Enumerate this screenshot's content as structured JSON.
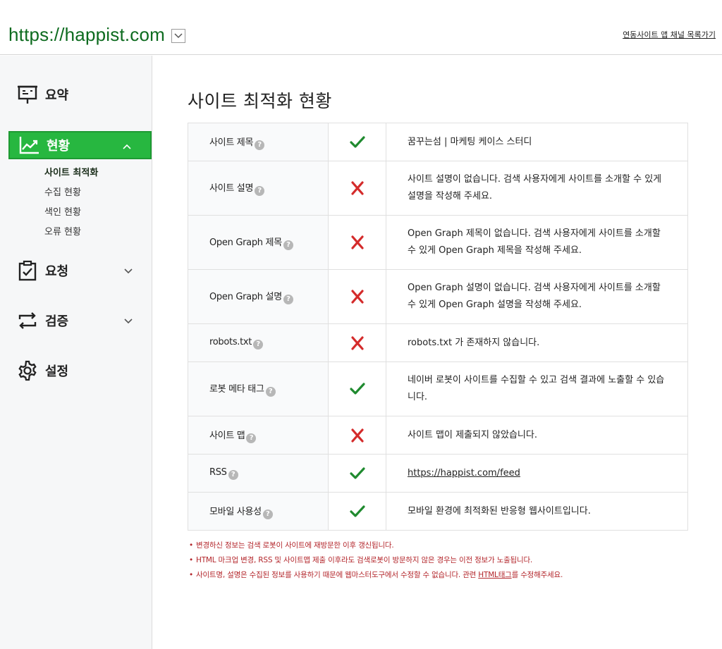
{
  "header": {
    "site_url": "https://happist.com",
    "link_label": "연동사이트 앱 채널 목록가기"
  },
  "sidebar": {
    "items": [
      {
        "label": "요약",
        "icon": "presentation-board-icon"
      },
      {
        "label": "현황",
        "icon": "trend-chart-icon",
        "active": true
      },
      {
        "label": "요청",
        "icon": "clipboard-check-icon"
      },
      {
        "label": "검증",
        "icon": "swap-arrows-icon"
      },
      {
        "label": "설정",
        "icon": "gear-icon"
      }
    ],
    "sub_items": [
      "사이트 최적화",
      "수집 현황",
      "색인 현황",
      "오류 현황"
    ]
  },
  "main": {
    "title": "사이트 최적화 현황",
    "rows": [
      {
        "label": "사이트 제목",
        "status": "ok",
        "message": "꿈꾸는섬 | 마케팅 케이스 스터디"
      },
      {
        "label": "사이트 설명",
        "status": "error",
        "message": "사이트 설명이 없습니다. 검색 사용자에게 사이트를 소개할 수 있게 설명을 작성해 주세요."
      },
      {
        "label": "Open Graph 제목",
        "status": "error",
        "message": "Open Graph 제목이 없습니다. 검색 사용자에게 사이트를 소개할 수 있게 Open Graph 제목을 작성해 주세요."
      },
      {
        "label": "Open Graph 설명",
        "status": "error",
        "message": "Open Graph 설명이 없습니다. 검색 사용자에게 사이트를 소개할 수 있게 Open Graph 설명을 작성해 주세요."
      },
      {
        "label": "robots.txt",
        "status": "error",
        "message": "robots.txt 가 존재하지 않습니다."
      },
      {
        "label": "로봇 메타 태그",
        "status": "ok",
        "message": "네이버 로봇이 사이트를 수집할 수 있고 검색 결과에 노출할 수 있습니다."
      },
      {
        "label": "사이트 맵",
        "status": "error",
        "message": "사이트 맵이 제출되지 않았습니다."
      },
      {
        "label": "RSS",
        "status": "ok",
        "message": "https://happist.com/feed"
      },
      {
        "label": "모바일 사용성",
        "status": "ok",
        "message": "모바일 환경에 최적화된 반응형 웹사이트입니다."
      }
    ],
    "help_glyph": "?",
    "notes": [
      "변경하신 정보는 검색 로봇이 사이트에 재방문한 이후 갱신됩니다.",
      "HTML 마크업 변경, RSS 및 사이트맵 제출 이후라도 검색로봇이 방문하지 않은 경우는 이전 정보가 노출됩니다."
    ],
    "note3_prefix": "사이트명, 설명은 수집된 정보를 사용하기 때문에 웹마스터도구에서 수정할 수 없습니다. 관련 ",
    "note3_link": "HTML태그",
    "note3_suffix": "를 수정해주세요.",
    "bullet": "•"
  },
  "colors": {
    "brand_green": "#27b740",
    "url_green": "#0d6b1f",
    "ok": "#1f8a2f",
    "error": "#d42b2b",
    "note_red": "#b3262b"
  }
}
